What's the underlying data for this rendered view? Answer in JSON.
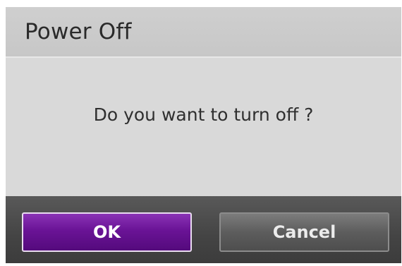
{
  "dialog": {
    "title": "Power Off",
    "message": "Do you want to turn off ?",
    "buttons": {
      "ok_label": "OK",
      "cancel_label": "Cancel"
    }
  },
  "colors": {
    "ok_button": "#6a1396",
    "cancel_button": "#5d5d5d",
    "title_bar": "#c9c9c9",
    "body": "#d9d9d9",
    "button_bar": "#444444"
  }
}
